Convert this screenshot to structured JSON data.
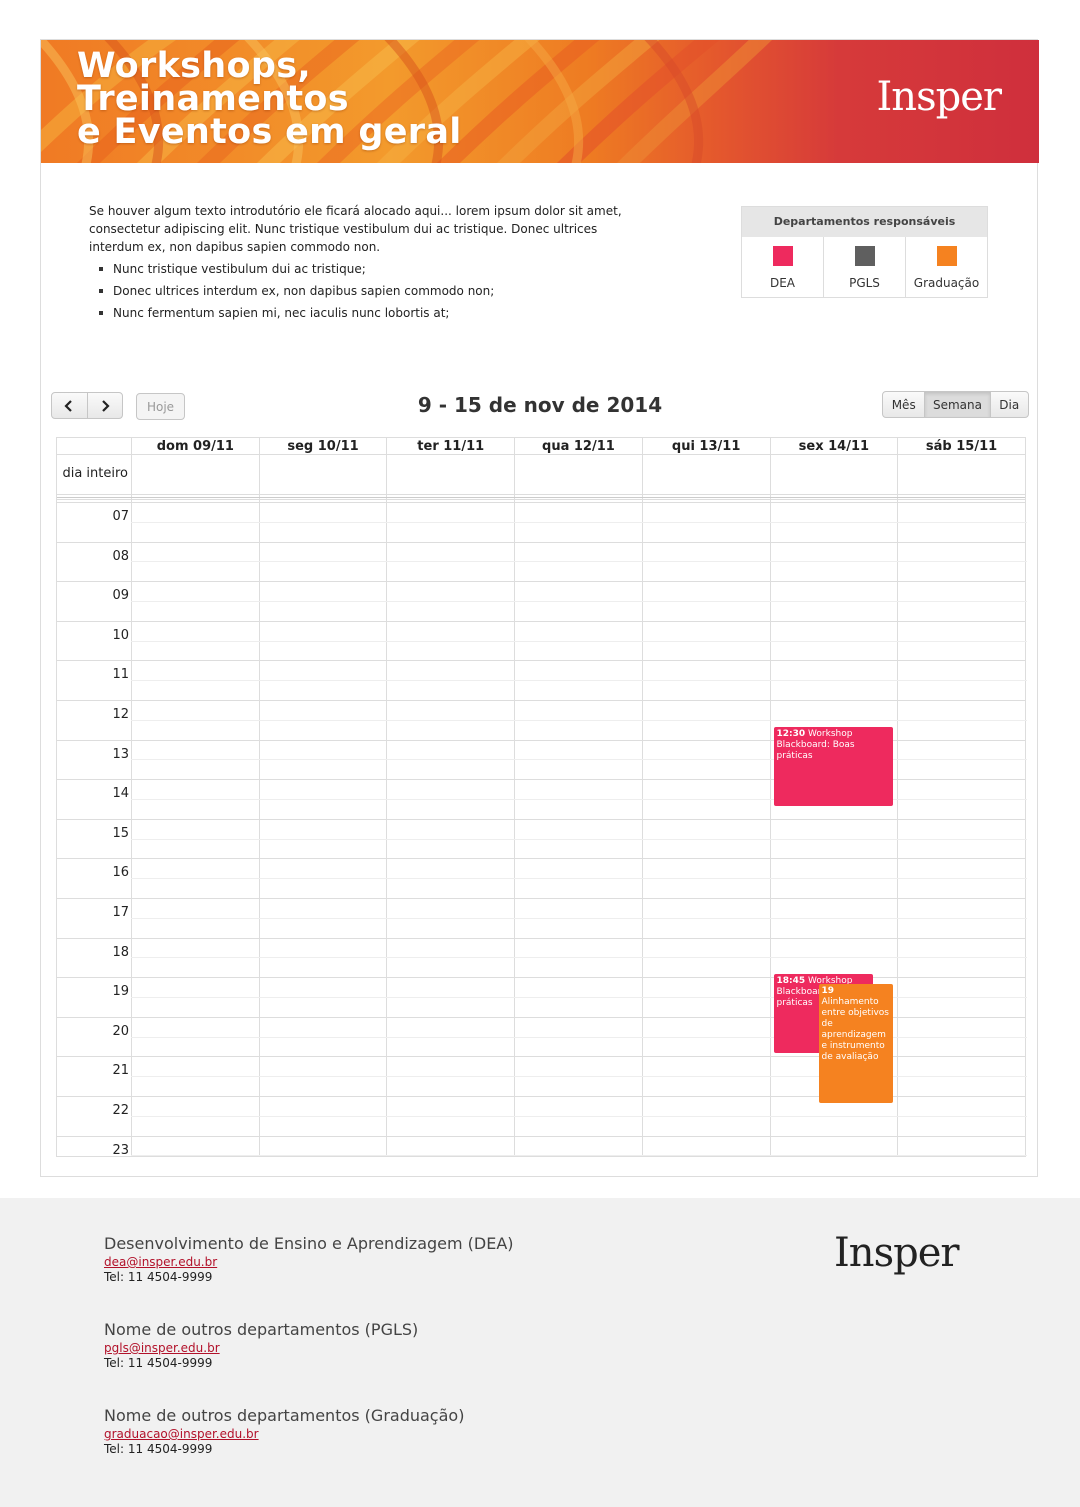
{
  "banner": {
    "title_lines": [
      "Workshops,",
      "Treinamentos",
      "e Eventos em geral"
    ],
    "logo": "Insper"
  },
  "intro": {
    "paragraph": "Se houver algum texto introdutório ele ficará alocado aqui... lorem ipsum dolor sit amet, consectetur adipiscing elit. Nunc tristique vestibulum dui ac tristique. Donec ultrices interdum ex, non dapibus sapien commodo non.",
    "bullets": [
      "Nunc tristique vestibulum dui ac tristique;",
      "Donec ultrices interdum ex, non dapibus sapien commodo non;",
      "Nunc fermentum sapien mi, nec iaculis nunc lobortis at;"
    ]
  },
  "legend": {
    "title": "Departamentos responsáveis",
    "items": [
      {
        "label": "DEA",
        "color": "#ee2a5e"
      },
      {
        "label": "PGLS",
        "color": "#5f5f5f"
      },
      {
        "label": "Graduação",
        "color": "#f58220"
      }
    ]
  },
  "toolbar": {
    "prev_icon": "chevron-left-icon",
    "next_icon": "chevron-right-icon",
    "today_label": "Hoje",
    "title": "9 - 15 de nov de 2014",
    "views": [
      "Mês",
      "Semana",
      "Dia"
    ],
    "active_view": "Semana"
  },
  "calendar": {
    "days": [
      "dom 09/11",
      "seg 10/11",
      "ter 11/11",
      "qua 12/11",
      "qui 13/11",
      "sex 14/11",
      "sáb 15/11"
    ],
    "allday_label": "dia inteiro",
    "hours": [
      "07",
      "08",
      "09",
      "10",
      "11",
      "12",
      "13",
      "14",
      "15",
      "16",
      "17",
      "18",
      "19",
      "20",
      "21",
      "22",
      "23"
    ],
    "events": [
      {
        "time": "12:30",
        "title": "Workshop Blackboard: Boas práticas",
        "day": "sex 14/11",
        "start": "12:30",
        "end": "14:30",
        "dept": "DEA",
        "color": "#ee2a5e"
      },
      {
        "time": "18:45",
        "title": "Workshop Blackboard: Boas práticas",
        "day": "sex 14/11",
        "start": "18:45",
        "end": "20:45",
        "dept": "DEA",
        "color": "#ee2a5e"
      },
      {
        "time": "19",
        "title": "Alinhamento entre objetivos de aprendizagem e instrumento de avaliação",
        "day": "sex 14/11",
        "start": "19:00",
        "end": "22:00",
        "dept": "Graduação",
        "color": "#f58220"
      }
    ]
  },
  "footer": {
    "logo": "Insper",
    "departments": [
      {
        "name": "Desenvolvimento de Ensino e Aprendizagem (DEA)",
        "email": "dea@insper.edu.br",
        "tel": "Tel: 11 4504-9999"
      },
      {
        "name": "Nome de outros departamentos (PGLS)",
        "email": "pgls@insper.edu.br",
        "tel": "Tel: 11 4504-9999"
      },
      {
        "name": "Nome de outros departamentos (Graduação)",
        "email": "graduacao@insper.edu.br",
        "tel": "Tel: 11 4504-9999"
      }
    ]
  }
}
